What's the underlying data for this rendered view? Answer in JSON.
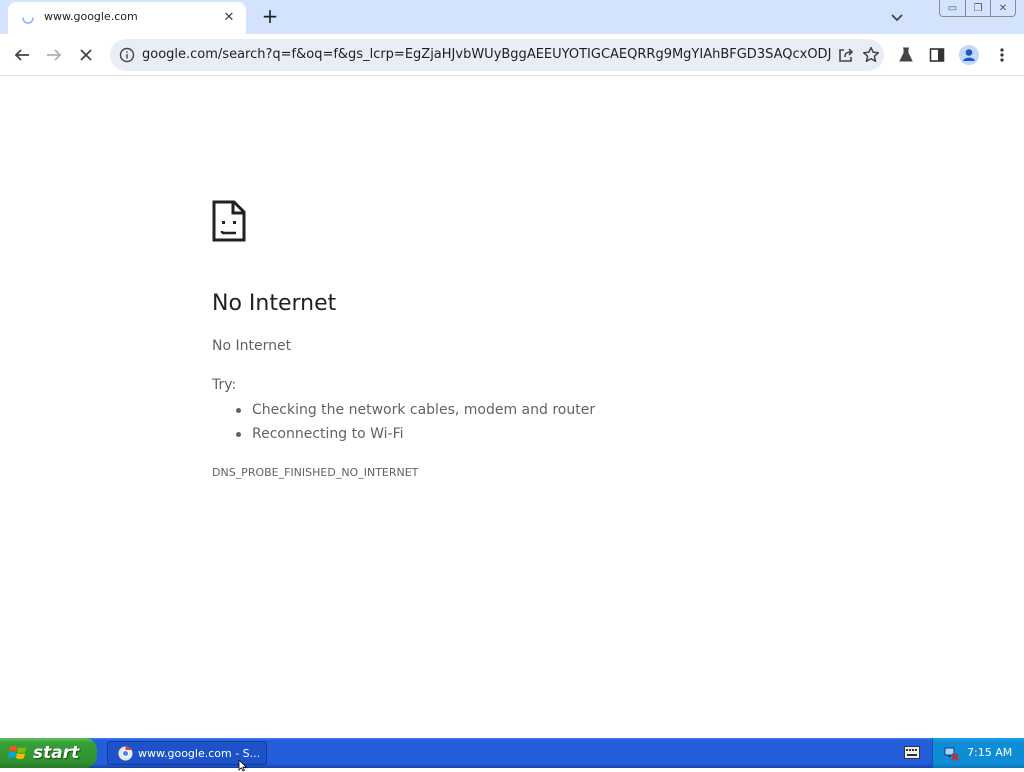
{
  "window": {
    "tab_title": "www.google.com",
    "tab_close_glyph": "✕",
    "new_tab_glyph": "+",
    "controls": {
      "minimize": "▭",
      "restore": "❐",
      "close": "✕"
    }
  },
  "toolbar": {
    "back_icon": "arrow-left-icon",
    "forward_icon": "arrow-right-icon",
    "stop_icon": "stop-loading-icon",
    "url": "google.com/search?q=f&oq=f&gs_lcrp=EgZjaHJvbWUyBggAEEUYOTIGCAEQRRg9MgYIAhBFGD3SAQcxODJq..."
  },
  "error_page": {
    "title": "No Internet",
    "subtitle": "No Internet",
    "try_label": "Try:",
    "suggestions": [
      "Checking the network cables, modem and router",
      "Reconnecting to Wi-Fi"
    ],
    "error_code": "DNS_PROBE_FINISHED_NO_INTERNET"
  },
  "taskbar": {
    "start_label": "start",
    "task_label": "www.google.com - S...",
    "clock": "7:15 AM"
  },
  "colors": {
    "tab_strip": "#d3e3fd",
    "omnibox": "#e9eef6",
    "taskbar": "#245edb",
    "start_button": "#37a037",
    "tray": "#0f8cd6"
  }
}
